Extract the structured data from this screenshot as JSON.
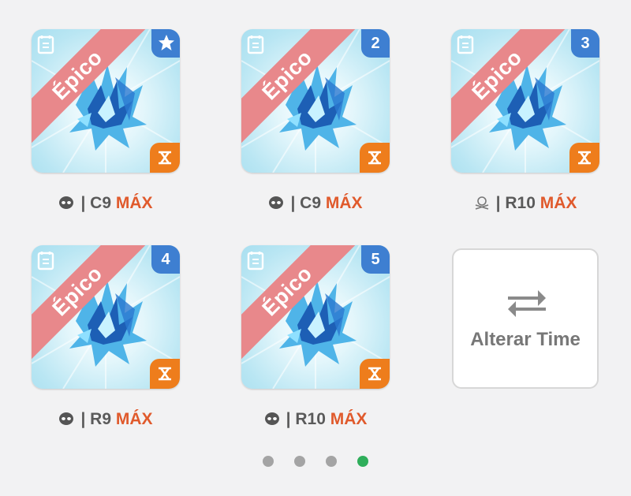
{
  "cards": [
    {
      "rarity": "Épico",
      "badge_icon": "star-icon",
      "badge": "",
      "level": "C9",
      "max": "MÁX",
      "type_icon": "skull-icon",
      "element_icon": "element-icon"
    },
    {
      "rarity": "Épico",
      "badge": "2",
      "level": "C9",
      "max": "MÁX",
      "type_icon": "skull-icon",
      "element_icon": "element-icon"
    },
    {
      "rarity": "Épico",
      "badge": "3",
      "level": "R10",
      "max": "MÁX",
      "type_icon": "crossbones-icon",
      "element_icon": "element-icon"
    },
    {
      "rarity": "Épico",
      "badge": "4",
      "level": "R9",
      "max": "MÁX",
      "type_icon": "skull-icon",
      "element_icon": "element-icon"
    },
    {
      "rarity": "Épico",
      "badge": "5",
      "level": "R10",
      "max": "MÁX",
      "type_icon": "skull-icon",
      "element_icon": "element-icon"
    }
  ],
  "separator": "|",
  "switch_team": {
    "label": "Alterar Time",
    "icon": "swap-arrows-icon"
  },
  "pagination": {
    "pages": 4,
    "active_page": 4
  },
  "colors": {
    "rarity_ribbon": "#e8888b",
    "badge": "#3e7fd1",
    "element": "#ee7d1c",
    "max_text": "#e05a2c",
    "active_dot": "#2fae5a"
  }
}
